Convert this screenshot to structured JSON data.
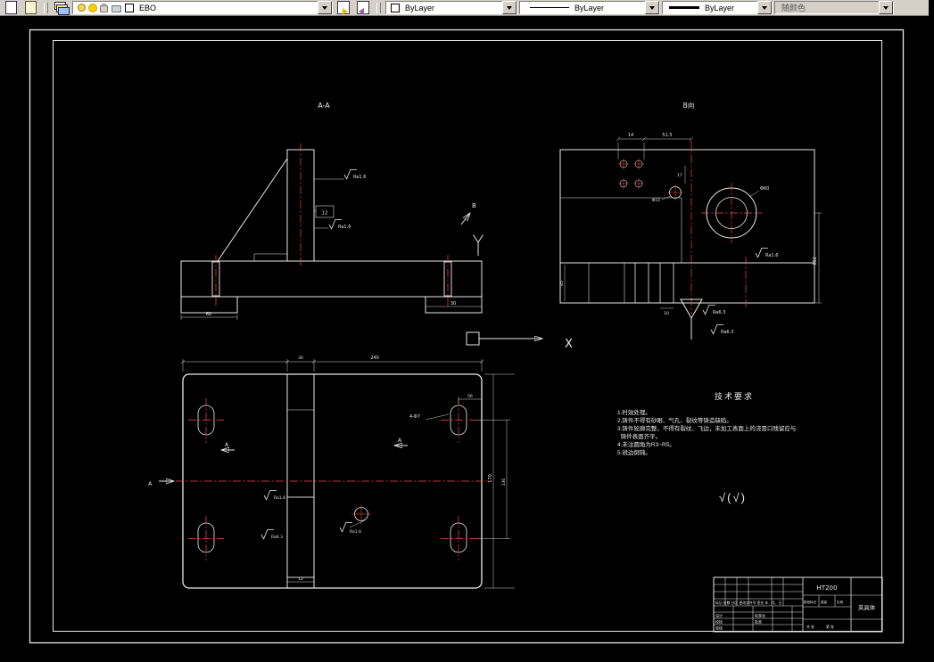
{
  "toolbar": {
    "layer_combo": {
      "value": "EBO"
    },
    "color_combo": {
      "value": "ByLayer"
    },
    "linetype_combo": {
      "value": "ByLayer"
    },
    "lineweight_combo": {
      "value": "ByLayer"
    },
    "plotstyle_combo": {
      "value": "随颜色"
    }
  },
  "drawing": {
    "labels": {
      "section_aa": "A-A",
      "view_b": "B向",
      "axis_x": "X",
      "arrow_b": "B",
      "arrow_a_left": "A",
      "arrow_a_mid1": "A",
      "arrow_a_mid2": "A",
      "finish_note": "√(√)"
    },
    "tech": {
      "title": "技术要求",
      "items": [
        "1.时效处理。",
        "2.铸件不得有砂眼、气孔、裂纹等铸造缺陷。",
        "3.铸件轮廓完整，不得有裂纹、飞边，未加工表面上的浇冒口残留应与",
        "  铸件表面齐平。",
        "4.未注圆角为R3~R5。",
        "5.锐边倒钝。"
      ]
    },
    "dims": {
      "aa_ra_top": "Ra1.6",
      "aa_ra_mid": "Ra1.6",
      "aa_box": "12",
      "aa_left": "60",
      "aa_right": "30",
      "b_14": "14",
      "b_51_5": "51.5",
      "b_17": "17",
      "b_phi10": "Φ10",
      "b_phi60": "Φ60",
      "b_right": "102",
      "b_85": "85",
      "b_10": "10",
      "b_ra63_a": "Ra6.3",
      "b_ra63_b": "Ra6.3",
      "b_ra16": "Ra1.6",
      "p_width": "240",
      "p_30": "30",
      "p_h_outer": "170",
      "p_h_inner": "130",
      "p_56": "56",
      "p_holes": "4-Φ7",
      "p_ra16_a": "Ra1.6",
      "p_ra16_b": "Ra1.6",
      "p_ra63": "Ra6.3",
      "p_12": "12"
    },
    "title_block": {
      "material": "HT200",
      "part_name": "夹具体",
      "header_row": "标记 处数 分区 更改文件号 签名 年、月、日",
      "row_design": "设计",
      "row_check": "校核",
      "row_audit": "审核",
      "row_std": "标准化",
      "row_approve": "批准",
      "stage": "阶段标记",
      "weight": "重量",
      "scale": "比例",
      "sheet_total": "共 张",
      "sheet_no": "第 张"
    }
  }
}
